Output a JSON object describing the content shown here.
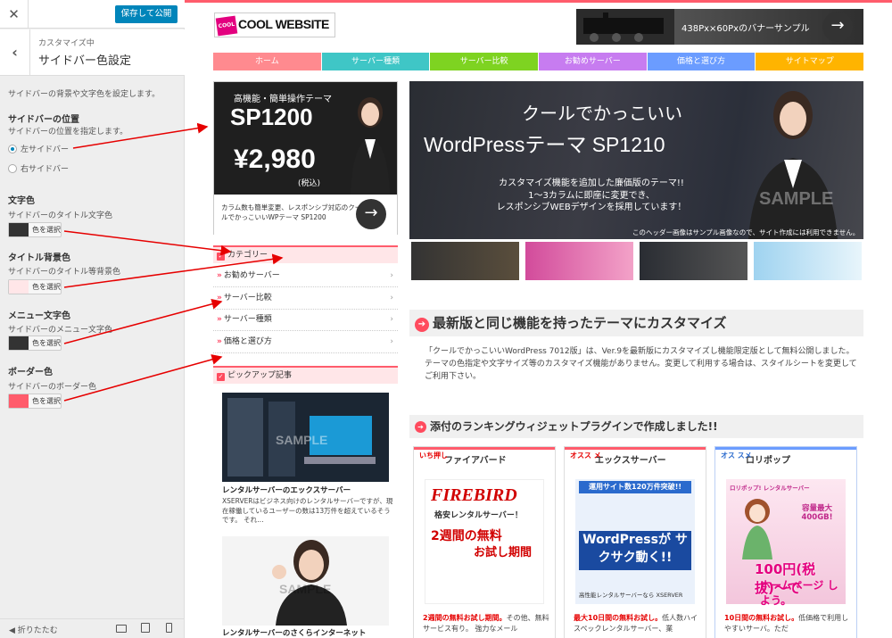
{
  "customizer": {
    "close_label": "✕",
    "publish_label": "保存して公開",
    "back_label": "‹",
    "subtitle": "カスタマイズ中",
    "title": "サイドバー色設定",
    "description": "サイドバーの背景や文字色を設定します。",
    "position_heading": "サイドバーの位置",
    "position_help": "サイドバーの位置を指定します。",
    "position_options": [
      "左サイドバー",
      "右サイドバー"
    ],
    "position_selected": "左サイドバー",
    "color_fields": [
      {
        "heading": "文字色",
        "help": "サイドバーのタイトル文字色",
        "button": "色を選択",
        "color": "#333333"
      },
      {
        "heading": "タイトル背景色",
        "help": "サイドバーのタイトル等背景色",
        "button": "色を選択",
        "color": "#ffe6e8"
      },
      {
        "heading": "メニュー文字色",
        "help": "サイドバーのメニュー文字色",
        "button": "色を選択",
        "color": "#333333"
      },
      {
        "heading": "ボーダー色",
        "help": "サイドバーのボーダー色",
        "button": "色を選択",
        "color": "#ff5c6c"
      }
    ],
    "collapse_label": "折りたたむ",
    "device_icons": [
      "desktop-icon",
      "tablet-icon",
      "mobile-icon"
    ],
    "accent_color": "#0085ba"
  },
  "site": {
    "logo_badge": "COOL",
    "logo_text": "COOL WEBSITE",
    "banner_text": "438Px×60Pxのバナーサンプル",
    "banner_arrow": "→",
    "nav": [
      {
        "label": "ホーム",
        "color": "#ff8a8f"
      },
      {
        "label": "サーバー種類",
        "color": "#3fc6c6"
      },
      {
        "label": "サーバー比較",
        "color": "#7ed321"
      },
      {
        "label": "お勧めサーバー",
        "color": "#c77cf0"
      },
      {
        "label": "価格と選び方",
        "color": "#6b9cff"
      },
      {
        "label": "サイトマップ",
        "color": "#ffb400"
      }
    ],
    "side_promo": {
      "line1": "高機能・簡単操作テーマ",
      "line2": "SP1200",
      "price": "¥2,980",
      "tax": "(税込)",
      "desc": "カラム数も簡単変更、レスポンシブ対応のクールでかっこいいWPテーマ SP1200",
      "arrow": "→"
    },
    "category_title": "カテゴリー",
    "categories": [
      "お勧めサーバー",
      "サーバー比較",
      "サーバー種類",
      "価格と選び方"
    ],
    "pickup_title": "ピックアップ記事",
    "pickup": [
      {
        "title": "レンタルサーバーのエックスサーバー",
        "desc": "XSERVERはビジネス向けのレンタルサーバーですが、現在稼働しているユーザーの数は13万件を超えているそうです。 それ…",
        "watermark": "SAMPLE"
      },
      {
        "title": "レンタルサーバーのさくらインターネット",
        "desc": "",
        "watermark": "SAMPLE"
      }
    ],
    "hero": {
      "line1": "クールでかっこいい",
      "line2": "WordPressテーマ SP1210",
      "line3": "カスタマイズ機能を追加した廉価版のテーマ!!\n1〜3カラムに即座に変更でき、\nレスポンシブWEBデザインを採用しています！",
      "note": "このヘッダー画像はサンプル画像なので、サイト作成には利用できません。",
      "watermark": "SAMPLE"
    },
    "section1_title": "最新版と同じ機能を持ったテーマにカスタマイズ",
    "section1_text": "「クールでかっこいいWordPress 7012版」は、Ver.9を最新版にカスタマイズし機能限定版として無料公開しました。\nテーマの色指定や文字サイズ等のカスタマイズ機能がありません。変更して利用する場合は、スタイルシートを変更してご利用下さい。",
    "section2_title": "添付のランキングウィジェットプラグインで作成しました!!",
    "ranking": [
      {
        "tag": "いち押し",
        "name": "ファイアバード",
        "border": "#ff5c6c",
        "img": {
          "logo": "FIREBIRD",
          "sub": "格安レンタルサーバー！",
          "big": "2週間の無料",
          "big2": "お試し期間"
        },
        "bold": "2週間の無料お試し期間。",
        "text": "その他、無料サービス有り。 強力なメール"
      },
      {
        "tag": "オスス メ",
        "name": "エックスサーバー",
        "border": "#ff5c6c",
        "img": {
          "top": "運用サイト数120万件突破!!",
          "main": "WordPressが サクサク動く!!",
          "foot": "高性能レンタルサーバーなら XSERVER"
        },
        "bold": "最大10日間の無料お試し。",
        "text": "低人数ハイスペックレンタルサーバー、業"
      },
      {
        "tag": "オス スメ",
        "name": "ロリポップ",
        "border": "#6b9cff",
        "img": {
          "head": "ロリポップ! レンタルサーバー",
          "mid": "容量最大400GB!",
          "price": "100円(税抜)〜で",
          "price2": "ホームページ しよう。"
        },
        "bold": "10日間の無料お試し。",
        "text": "低価格で利用しやすいサーバ。ただ"
      }
    ]
  }
}
